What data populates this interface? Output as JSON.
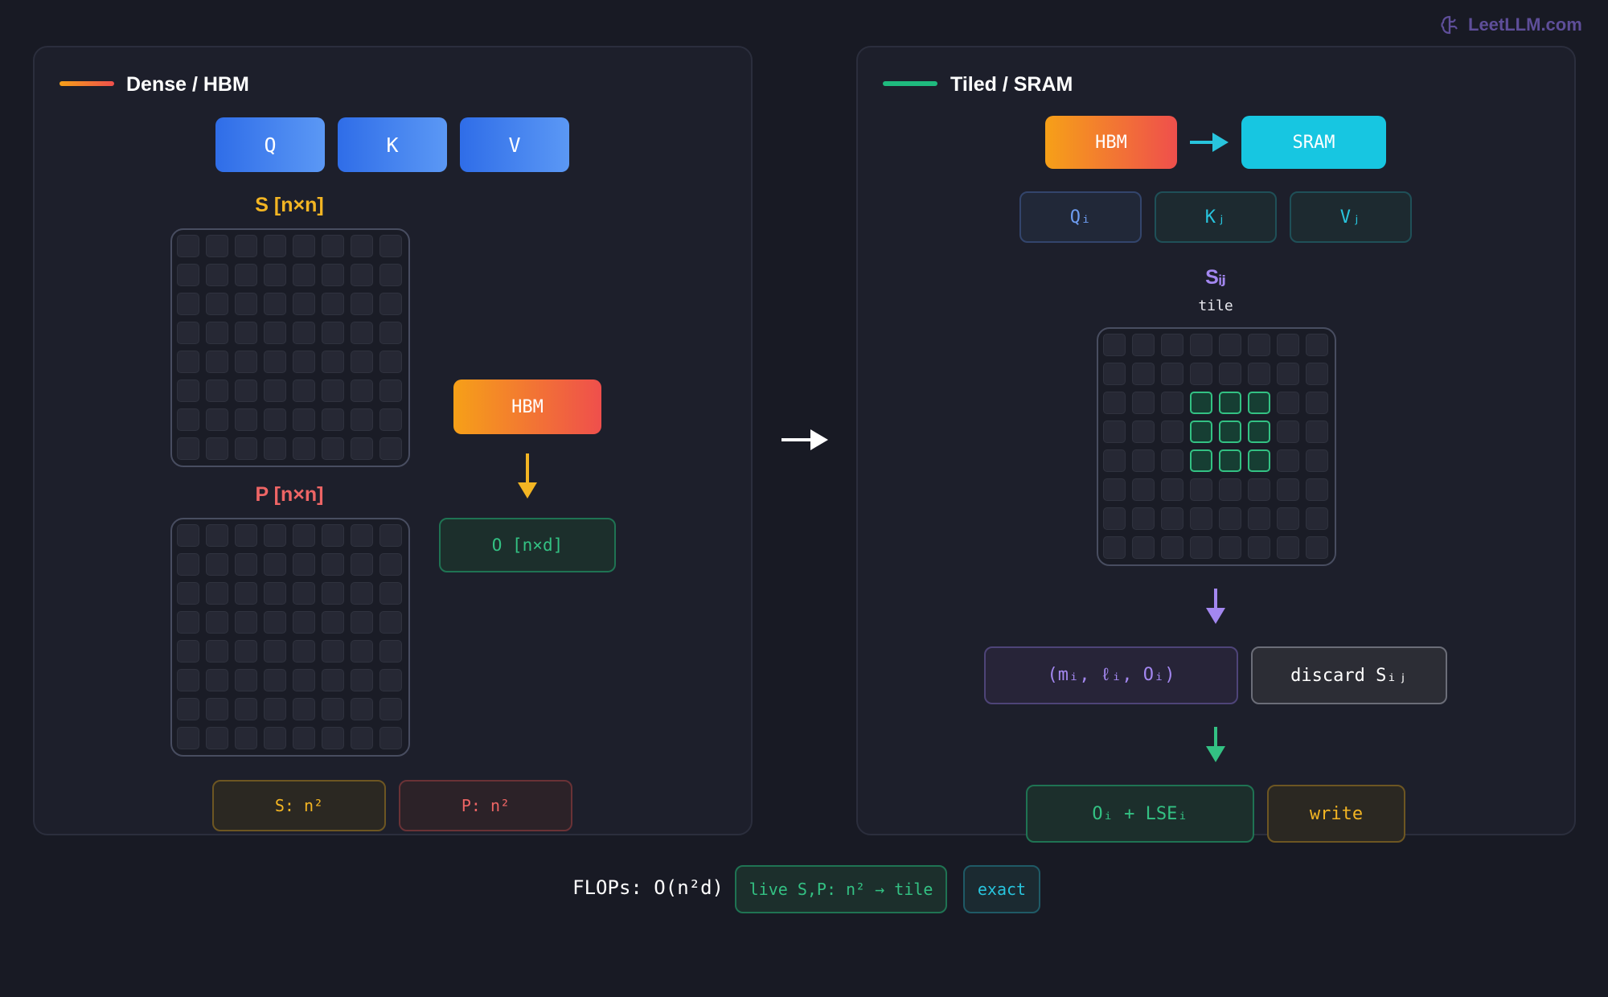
{
  "brand": {
    "name": "LeetLLM.com",
    "icon": "brain-icon",
    "color": "#5e4e99"
  },
  "left_panel": {
    "title": "Dense / HBM",
    "accent": "#f6861f",
    "qkv": [
      "Q",
      "K",
      "V"
    ],
    "s_label": "S [n×n]",
    "p_label": "P [n×n]",
    "hbm": "HBM",
    "output": "O [n×d]",
    "mem_s": "S: n²",
    "mem_p": "P: n²"
  },
  "right_panel": {
    "title": "Tiled / SRAM",
    "accent": "#1fba7e",
    "hbm": "HBM",
    "sram": "SRAM",
    "blocks": [
      "Qᵢ",
      "Kⱼ",
      "Vⱼ"
    ],
    "tile_label": "Sᵢⱼ",
    "tile_sublabel": "tile",
    "state": "(mᵢ, ℓᵢ, Oᵢ)",
    "discard": "discard Sᵢⱼ",
    "output": "Oᵢ + LSEᵢ",
    "write": "write"
  },
  "footer": {
    "flops": "FLOPs: O(n²d)",
    "memory": "live S,P: n² → tile",
    "exact": "exact"
  },
  "colors": {
    "yellow": "#f3b523",
    "red": "#ee6565",
    "green": "#33c183",
    "purple": "#a387f0",
    "cyan": "#28c4dd"
  }
}
